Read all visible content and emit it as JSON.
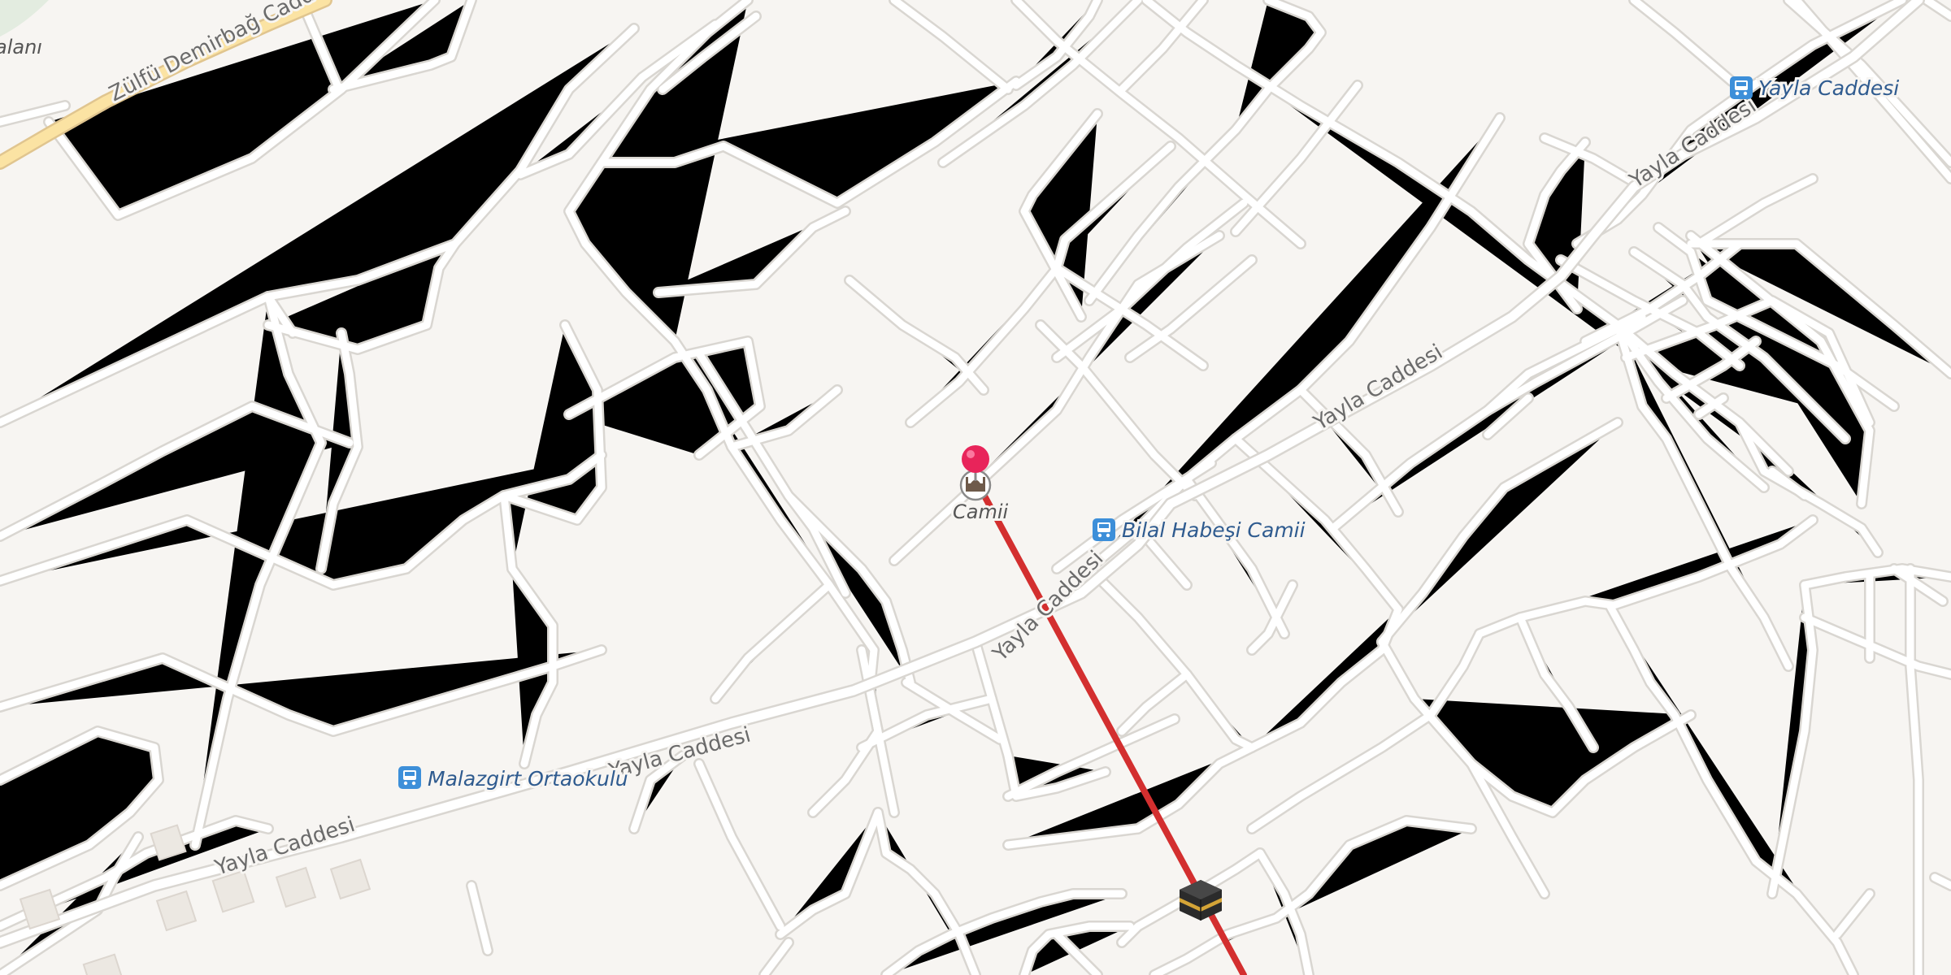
{
  "map": {
    "streets": {
      "zulfu": "Zülfü Demirbağ Caddesi",
      "yayla": "Yayla Caddesi"
    },
    "area_label_partial": "alanı",
    "pois": {
      "bus_stop_1": "Yayla Caddesi",
      "bus_stop_2": "Bilal Habeşi Camii",
      "bus_stop_3": "Malazgirt Ortaokulu",
      "mosque": "Camii"
    },
    "icons": [
      "bus-stop-icon",
      "mosque-icon",
      "location-pin-icon",
      "kaaba-icon"
    ],
    "colors": {
      "background": "#f7f5f2",
      "road": "#ffffff",
      "main_road": "#fbe3a3",
      "route_line": "#d32f2f",
      "pin": "#e8245a",
      "bus_icon": "#3d8fd9",
      "poi_text": "#2f5b8f"
    }
  }
}
